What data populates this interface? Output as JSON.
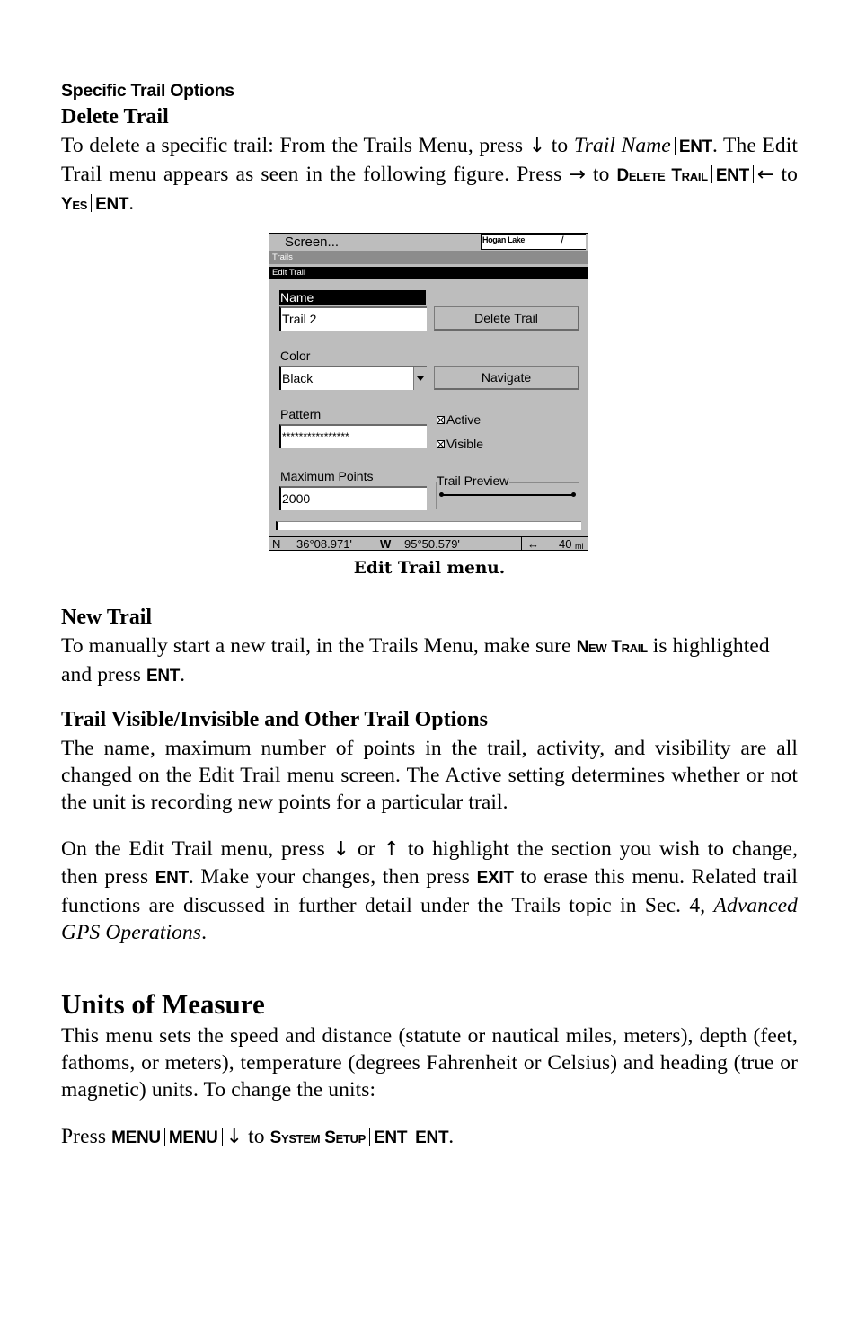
{
  "section_kicker": "Specific Trail Options",
  "delete_trail": {
    "heading": "Delete Trail",
    "body": {
      "t1": "To delete a specific trail: From the Trails Menu, press ",
      "arrow_down": "↓",
      "t2": " to ",
      "italic_trail_name": "Trail Name",
      "key_ent": "ENT",
      "t3": ". The Edit Trail menu appears as seen in the following figure. Press ",
      "arrow_right": "→",
      "t4": " to ",
      "key_delete_trail": "Delete Trail",
      "key_ent2": "ENT",
      "arrow_left": "←",
      "t5": " to ",
      "key_yes": "Yes",
      "key_ent3": "ENT",
      "t6": "."
    }
  },
  "figure": {
    "screen_label": "Screen...",
    "map_thumb_label": "Hogan Lake",
    "trails_bar": "Trails",
    "edit_bar": "Edit Trail",
    "name_label": "Name",
    "name_value": "Trail 2",
    "delete_button": "Delete Trail",
    "color_label": "Color",
    "color_value": "Black",
    "navigate_button": "Navigate",
    "pattern_label": "Pattern",
    "pattern_value": "****************",
    "active_label": "Active",
    "active_checked": true,
    "visible_label": "Visible",
    "visible_checked": true,
    "max_points_label": "Maximum Points",
    "max_points_value": "2000",
    "trail_preview_label": "Trail Preview",
    "status": {
      "lat_hemi": "N",
      "lat": "36°08.971'",
      "lon_hemi": "W",
      "lon": "95°50.579'",
      "range_icon": "↔",
      "range_value": "40",
      "range_unit": "mi"
    },
    "caption": "Edit Trail menu."
  },
  "new_trail": {
    "heading": "New Trail",
    "t1": "To manually start a new trail, in the Trails Menu, make sure ",
    "key_new_trail": "New Trail",
    "t2": " is highlighted and press ",
    "key_ent": "ENT",
    "t3": "."
  },
  "visible_section": {
    "heading": "Trail Visible/Invisible and Other Trail Options",
    "p1": "The name, maximum number of points in the trail, activity, and visibility are all changed on the Edit Trail menu screen. The Active setting determines whether or not the unit is recording new points for a particular trail.",
    "p2": {
      "t1": "On the Edit Trail menu, press ",
      "arrow_down": "↓",
      "t2": " or ",
      "arrow_up": "↑",
      "t3": " to highlight the section you wish to change, then press ",
      "key_ent": "ENT",
      "t4": ". Make your changes, then press ",
      "key_exit": "EXIT",
      "t5": " to erase this menu. Related trail functions are discussed in further detail under the Trails topic in Sec. 4, ",
      "italic_ref": "Advanced GPS Operations",
      "t6": "."
    }
  },
  "units": {
    "heading": "Units of Measure",
    "p1": "This menu sets the speed and distance (statute or nautical miles, meters), depth (feet, fathoms, or meters), temperature (degrees Fahrenheit or Celsius) and heading (true or magnetic) units. To change the units:",
    "p2": {
      "t1": "Press ",
      "key_menu1": "MENU",
      "key_menu2": "MENU",
      "arrow_down": "↓",
      "t2": " to ",
      "key_system_setup": "System Setup",
      "key_ent1": "ENT",
      "key_ent2": "ENT",
      "t3": "."
    }
  }
}
